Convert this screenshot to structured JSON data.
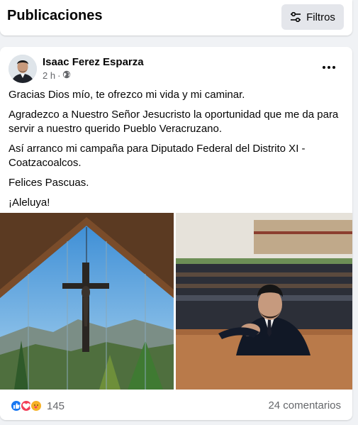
{
  "header": {
    "title": "Publicaciones",
    "filters_label": "Filtros"
  },
  "post": {
    "author": "Isaac Ferez Esparza",
    "time": "2 h",
    "separator": "·",
    "audience_icon": "globe-icon",
    "paragraphs": [
      "Gracias Dios mío, te ofrezco mi vida y mi caminar.",
      "Agradezco a Nuestro Señor Jesucristo la oportunidad que me da para servir a nuestro querido Pueblo Veracruzano.",
      "Así arranco mi campaña para Diputado Federal del Distrito XI - Coatzacoalcos.",
      "Felices Pascuas.",
      "¡Aleluya!"
    ],
    "reaction_icons": [
      "like-icon",
      "love-icon",
      "care-icon"
    ],
    "reactions_count": "145",
    "comments": "24 comentarios"
  },
  "colors": {
    "like": "#1877f2",
    "love": "#f33e58",
    "care": "#f7b125",
    "secondary_text": "#65676b",
    "background": "#f0f2f5"
  }
}
